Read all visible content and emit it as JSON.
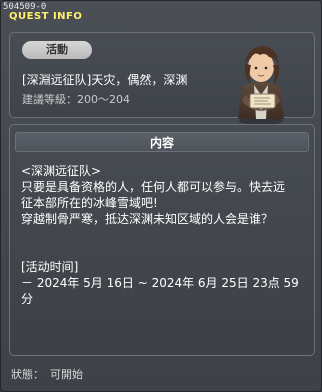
{
  "window": {
    "id": "504509-0",
    "title": "QUEST INFO"
  },
  "header": {
    "badge": "活動",
    "quest_title": "[深淵远征队]天灾，偶然，深渊",
    "level_label": "建議等級：",
    "level_value": "200～204",
    "npc_icon": "scroll-holding-npc-icon"
  },
  "content": {
    "section_title": "内容",
    "lines": [
      "<深渊远征队>",
      "只要是具备资格的人，任何人都可以参与。快去远",
      "征本部所在的冰峰雪域吧!",
      "穿越制骨严寒，抵达深渊未知区域的人会是谁？"
    ],
    "period_title": "[活动时间]",
    "period_value_1": "－ 2024年 5月 16日 ~ 2024年 6月 25日 23点 59",
    "period_value_2": "分"
  },
  "footer": {
    "status_label": "狀態：",
    "status_value": "可開始"
  },
  "colors": {
    "title_yellow": "#fff06a",
    "panel_border": "#6d7279",
    "background": "#3e4248",
    "text_white": "#ffffff",
    "text_gray": "#c9c9c9"
  }
}
